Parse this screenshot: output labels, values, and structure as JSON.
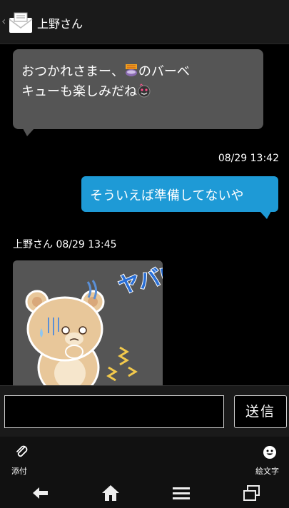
{
  "header": {
    "title": "上野さん",
    "back_icon": "chevron-left-icon",
    "avatar_icon": "envelope-icon"
  },
  "messages": [
    {
      "direction": "incoming",
      "line1": "おつかれさまー、",
      "line1b": "のバーベ",
      "line2": "キューも楽しみだね",
      "emojis": [
        "bbq-emoji",
        "smiling-face-emoji"
      ]
    },
    {
      "direction": "outgoing",
      "timestamp": "08/29 13:42",
      "text": "そういえば準備してないや"
    },
    {
      "direction": "incoming",
      "sender_line": "上野さん 08/29 13:45",
      "type": "sticker",
      "sticker_text": "ヤバい"
    }
  ],
  "composer": {
    "input_value": "",
    "send_label": "送信"
  },
  "tools": {
    "attach_label": "添付",
    "emoji_label": "絵文字"
  },
  "nav": {
    "icons": [
      "back-arrow-icon",
      "home-icon",
      "menu-icon",
      "recent-apps-icon"
    ]
  },
  "colors": {
    "outgoing_bubble": "#1e9ad6",
    "incoming_bubble": "#555555",
    "background": "#000000"
  }
}
